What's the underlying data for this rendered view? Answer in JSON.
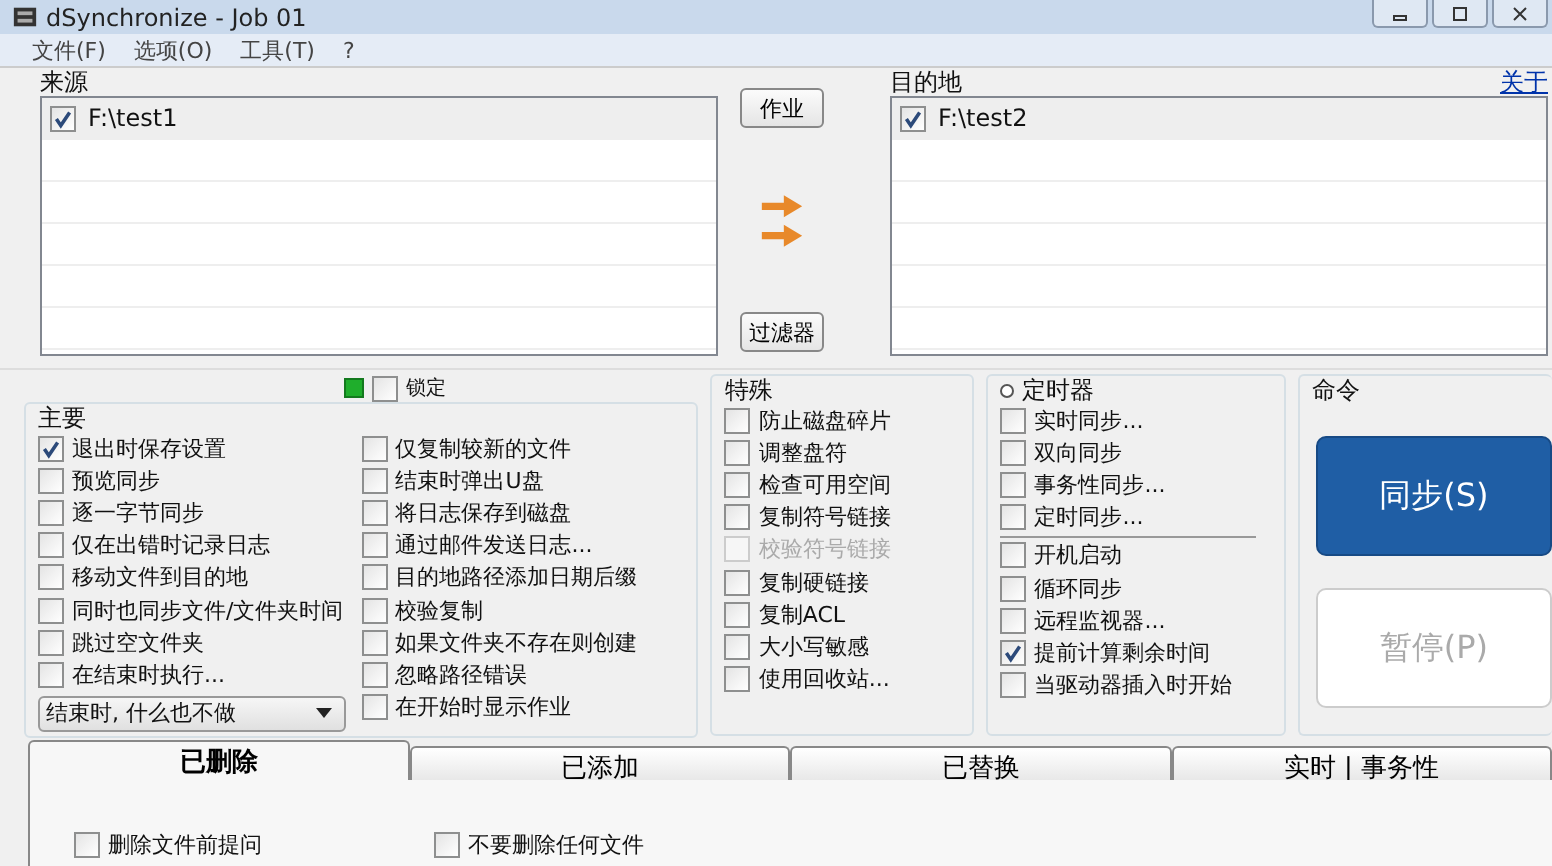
{
  "window": {
    "title": "dSynchronize - Job 01"
  },
  "menu": [
    "文件(F)",
    "选项(O)",
    "工具(T)",
    "?"
  ],
  "source": {
    "label": "来源",
    "items": [
      {
        "path": "F:\\test1",
        "checked": true
      }
    ]
  },
  "middle": {
    "buttons": [
      "作业",
      "过滤器"
    ]
  },
  "destination": {
    "label": "目的地",
    "link": "关于",
    "items": [
      {
        "path": "F:\\test2",
        "checked": true
      }
    ]
  },
  "lock": {
    "label": "锁定",
    "checked": false
  },
  "main": {
    "title": "主要",
    "left_options": [
      {
        "label": "退出时保存设置",
        "checked": true
      },
      {
        "label": "预览同步",
        "checked": false
      },
      {
        "label": "逐一字节同步",
        "checked": false
      },
      {
        "label": "仅在出错时记录日志",
        "checked": false
      },
      {
        "label": "移动文件到目的地",
        "checked": false
      },
      {
        "label": "同时也同步文件/文件夹时间",
        "checked": false
      },
      {
        "label": "跳过空文件夹",
        "checked": false
      },
      {
        "label": "在结束时执行...",
        "checked": false
      }
    ],
    "dropdown": {
      "value": "结束时, 什么也不做"
    },
    "right_options": [
      {
        "label": "仅复制较新的文件",
        "checked": false
      },
      {
        "label": "结束时弹出U盘",
        "checked": false
      },
      {
        "label": "将日志保存到磁盘",
        "checked": false
      },
      {
        "label": "通过邮件发送日志...",
        "checked": false
      },
      {
        "label": "目的地路径添加日期后缀",
        "checked": false
      },
      {
        "label": "校验复制",
        "checked": false
      },
      {
        "label": "如果文件夹不存在则创建",
        "checked": false
      },
      {
        "label": "忽略路径错误",
        "checked": false
      },
      {
        "label": "在开始时显示作业",
        "checked": false
      }
    ]
  },
  "special": {
    "title": "特殊",
    "options": [
      {
        "label": "防止磁盘碎片",
        "checked": false,
        "disabled": false
      },
      {
        "label": "调整盘符",
        "checked": false,
        "disabled": false
      },
      {
        "label": "检查可用空间",
        "checked": false,
        "disabled": false
      },
      {
        "label": "复制符号链接",
        "checked": false,
        "disabled": false
      },
      {
        "label": "校验符号链接",
        "checked": false,
        "disabled": true
      },
      {
        "label": "复制硬链接",
        "checked": false,
        "disabled": false
      },
      {
        "label": "复制ACL",
        "checked": false,
        "disabled": false
      },
      {
        "label": "大小写敏感",
        "checked": false,
        "disabled": false
      },
      {
        "label": "使用回收站...",
        "checked": false,
        "disabled": false
      }
    ]
  },
  "timer": {
    "title": "定时器",
    "options": [
      {
        "label": "实时同步...",
        "checked": false
      },
      {
        "label": "双向同步",
        "checked": false
      },
      {
        "label": "事务性同步...",
        "checked": false
      },
      {
        "label": "定时同步...",
        "checked": false
      }
    ],
    "more_options": [
      {
        "label": "开机启动",
        "checked": false
      },
      {
        "label": "循环同步",
        "checked": false
      },
      {
        "label": "远程监视器...",
        "checked": false
      },
      {
        "label": "提前计算剩余时间",
        "checked": true
      },
      {
        "label": "当驱动器插入时开始",
        "checked": false
      }
    ]
  },
  "commands": {
    "title": "命令",
    "buttons": [
      {
        "label": "同步(S)",
        "disabled": false
      },
      {
        "label": "暂停(P)",
        "disabled": true
      }
    ]
  },
  "tabs": [
    {
      "label": "已删除",
      "selected": true
    },
    {
      "label": "已添加",
      "selected": false
    },
    {
      "label": "已替换",
      "selected": false
    },
    {
      "label": "实时 | 事务性",
      "selected": false
    }
  ],
  "tab_panel": {
    "options": [
      {
        "label": "删除文件前提问",
        "checked": false
      },
      {
        "label": "不要删除任何文件",
        "checked": false
      }
    ]
  }
}
